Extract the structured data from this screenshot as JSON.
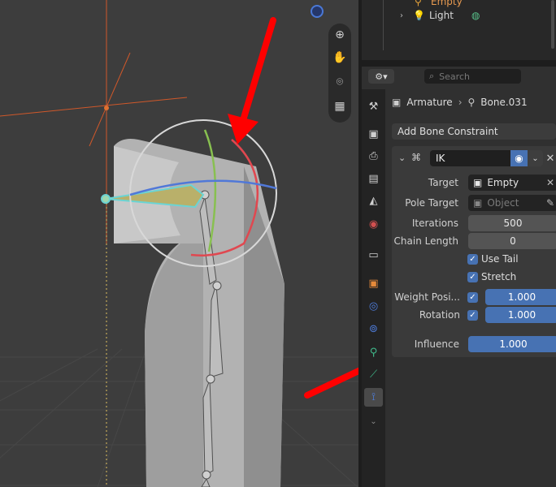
{
  "outliner": {
    "rows": [
      {
        "label": "Empty",
        "icon": "empty-icon"
      },
      {
        "label": "Light",
        "icon": "light-icon"
      }
    ]
  },
  "properties": {
    "search_placeholder": "Search",
    "breadcrumb": {
      "object": "Armature",
      "bone": "Bone.031"
    },
    "add_constraint_label": "Add Bone Constraint",
    "constraint": {
      "name": "IK",
      "target_label": "Target",
      "target_value": "Empty",
      "pole_target_label": "Pole Target",
      "pole_target_placeholder": "Object",
      "iterations_label": "Iterations",
      "iterations_value": "500",
      "chain_length_label": "Chain Length",
      "chain_length_value": "0",
      "use_tail_label": "Use Tail",
      "use_tail_checked": true,
      "stretch_label": "Stretch",
      "stretch_checked": true,
      "weight_position_label": "Weight Posi...",
      "weight_position_value": "1.000",
      "rotation_label": "Rotation",
      "rotation_value": "1.000",
      "influence_label": "Influence",
      "influence_value": "1.000"
    }
  },
  "colors": {
    "accent": "#4772b3",
    "annotation_arrow": "#ff0000",
    "bone_selected": "#6ad4d4"
  }
}
